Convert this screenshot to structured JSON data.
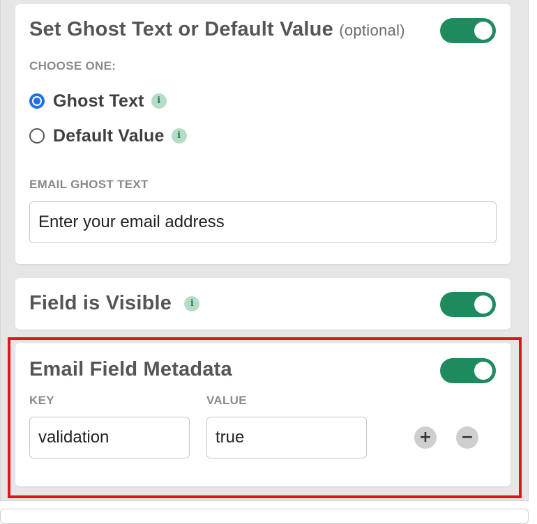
{
  "ghost_section": {
    "title": "Set Ghost Text or Default Value",
    "optional_label": "(optional)",
    "toggle_on": true,
    "choose_label": "CHOOSE ONE:",
    "options": [
      {
        "label": "Ghost Text",
        "selected": true
      },
      {
        "label": "Default Value",
        "selected": false
      }
    ],
    "input_label": "EMAIL GHOST TEXT",
    "input_value": "Enter your email address"
  },
  "visible_section": {
    "title": "Field is Visible",
    "toggle_on": true
  },
  "metadata_section": {
    "title": "Email Field Metadata",
    "toggle_on": true,
    "key_label": "KEY",
    "value_label": "VALUE",
    "key_value": "validation",
    "value_value": "true",
    "add_symbol": "+",
    "remove_symbol": "−"
  },
  "icons": {
    "info": "i"
  },
  "colors": {
    "toggle_on": "#1e8a5e",
    "radio_selected": "#1a73e8",
    "info_icon_bg": "#b5dcc6",
    "highlight": "#e0141c"
  }
}
